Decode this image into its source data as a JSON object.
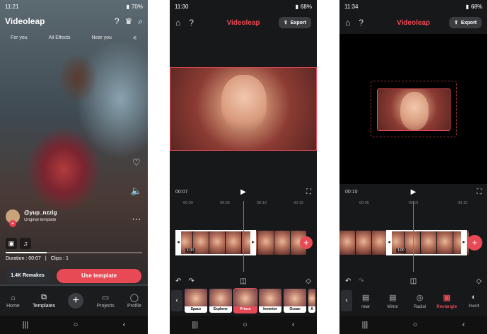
{
  "screen1": {
    "status": {
      "time": "11:21",
      "right": "70%"
    },
    "logo": "Videoleap",
    "filters": [
      "For you",
      "All Effects",
      "Near you"
    ],
    "username": "@yup_nzzig",
    "original": "Original template",
    "duration": "Duration : 00:07",
    "clips": "Clips : 1",
    "remakes": "1.4K Remakes",
    "use_template": "Use template",
    "tabs": [
      {
        "label": "Home",
        "icon": "home-icon"
      },
      {
        "label": "Templates",
        "icon": "templates-icon"
      },
      {
        "label": "Projects",
        "icon": "projects-icon"
      },
      {
        "label": "Profile",
        "icon": "profile-icon"
      }
    ]
  },
  "screen2": {
    "status": {
      "time": "11:30",
      "right": "68%"
    },
    "title": "Videoleap",
    "export": "Export",
    "time": "00:07",
    "ruler": [
      "00:00",
      "00:05",
      "00:10",
      "00:15"
    ],
    "clip_duration": "1.00",
    "effects": [
      "Space",
      "Explorer",
      "Prince",
      "Inventor",
      "Ocean",
      "A"
    ],
    "selected_effect": "Prince"
  },
  "screen3": {
    "status": {
      "time": "11:34",
      "right": "68%"
    },
    "title": "Videoleap",
    "export": "Export",
    "time": "00:10",
    "ruler": [
      "00:05",
      "00:10",
      "00:15"
    ],
    "clip_duration": "1.00",
    "shapes": [
      "near",
      "Mirror",
      "Radial",
      "Rectangle",
      "Invert"
    ],
    "selected_shape": "Rectangle"
  }
}
